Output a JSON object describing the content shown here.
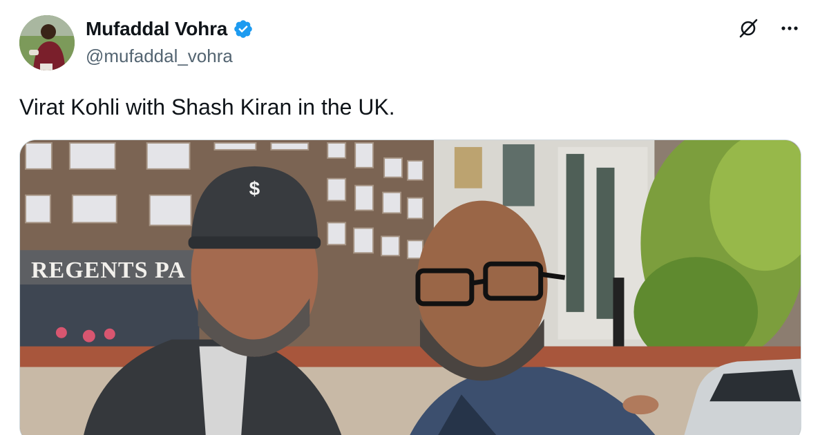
{
  "tweet": {
    "author": {
      "display_name": "Mufaddal Vohra",
      "handle": "@mufaddal_vohra",
      "verified": true,
      "verified_icon": "verified-badge-icon",
      "verified_color": "#1d9bf0"
    },
    "text": "Virat Kohli with Shash Kiran in the UK.",
    "actions": {
      "grok_icon": "grok-icon",
      "more_icon": "more-horizontal-icon"
    },
    "media": {
      "sign_text": "REGENTS PA"
    }
  }
}
